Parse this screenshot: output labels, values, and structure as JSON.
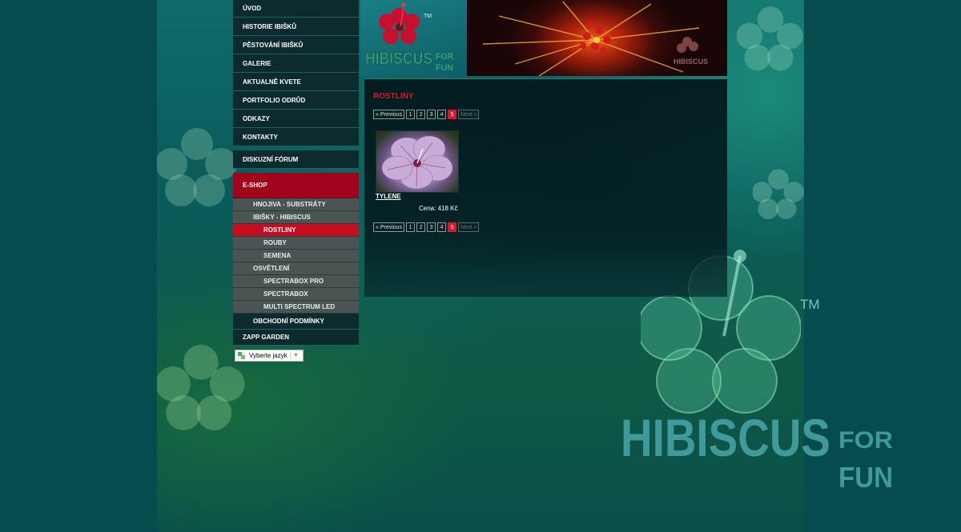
{
  "nav": {
    "items": [
      "ÚVOD",
      "HISTORIE IBIŠKŮ",
      "PĚSTOVÁNÍ IBIŠKŮ",
      "GALERIE",
      "AKTUALNĚ KVETE",
      "PORTFOLIO ODRŮD",
      "ODKAZY",
      "KONTAKTY"
    ],
    "forum": "DISKUZNÍ FÓRUM",
    "eshop": "E-SHOP",
    "eshop_sub": [
      {
        "label": "HNOJIVA - SUBSTRÁTY",
        "level": 1
      },
      {
        "label": "IBIŠKY - HIBISCUS",
        "level": 1
      },
      {
        "label": "ROSTLINY",
        "level": 2,
        "active": true
      },
      {
        "label": "ROUBY",
        "level": 2
      },
      {
        "label": "SEMENA",
        "level": 2
      },
      {
        "label": "OSVĚTLENÍ",
        "level": 1
      },
      {
        "label": "SPECTRABOX PRO",
        "level": 2
      },
      {
        "label": "SPECTRABOX",
        "level": 2
      },
      {
        "label": "MULTI SPECTRUM LED",
        "level": 2
      }
    ],
    "conditions": "OBCHODNÍ PODMÍNKY",
    "zapp": "ZAPP GARDEN"
  },
  "translate": {
    "label": "Vyberte jazyk"
  },
  "brand": {
    "name": "HIBISCUS",
    "for": "FOR",
    "fun": "FUN",
    "tm": "TM"
  },
  "content": {
    "heading": "ROSTLINY",
    "pager": {
      "prev": "« Previous",
      "pages": [
        "1",
        "2",
        "3",
        "4",
        "5"
      ],
      "current": "5",
      "next": "Next »"
    },
    "product": {
      "name": "TYLENE",
      "price_label": "Cena:",
      "price": "418 Kč"
    }
  },
  "colors": {
    "accent_red": "#d9182d",
    "eshop_red": "#a1031c",
    "nav_bg": "#0b2b2f",
    "sub_bg": "#495453"
  }
}
